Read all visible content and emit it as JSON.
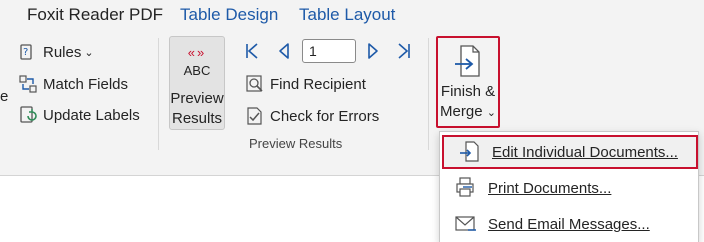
{
  "tabs": [
    {
      "label": "Foxit Reader PDF"
    },
    {
      "label": "Table Design"
    },
    {
      "label": "Table Layout"
    }
  ],
  "write_insert": {
    "rules_label": "Rules",
    "match_fields_label": "Match Fields",
    "update_labels_label": "Update Labels",
    "cut_off_char": "e"
  },
  "preview": {
    "abc_text": "ABC",
    "chevrons": "«»",
    "label_line1": "Preview",
    "label_line2": "Results",
    "record_number": "1",
    "find_recipient_label": "Find Recipient",
    "check_errors_label": "Check for Errors",
    "group_label": "Preview Results"
  },
  "finish": {
    "label_line1": "Finish &",
    "label_line2": "Merge",
    "dropdown_caret": "⌄"
  },
  "menu": {
    "items": [
      {
        "label": "Edit Individual Documents..."
      },
      {
        "label": "Print Documents..."
      },
      {
        "label": "Send Email Messages..."
      }
    ]
  },
  "colors": {
    "accent_blue": "#1e5aa8",
    "highlight_red": "#c8102e",
    "abc_red": "#c8102e"
  }
}
